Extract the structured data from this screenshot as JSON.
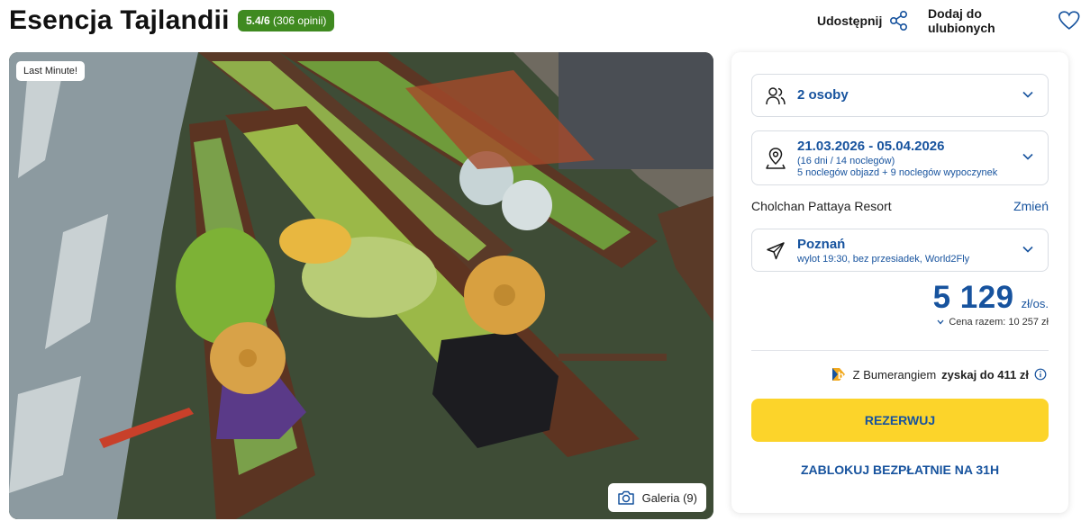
{
  "header": {
    "title": "Esencja Tajlandii",
    "rating": {
      "score": "5.4/6",
      "reviews": "(306 opinii)"
    },
    "share_label": "Udostępnij",
    "favorite_label": "Dodaj do ulubionych"
  },
  "gallery": {
    "badge": "Last Minute!",
    "button_label": "Galeria (9)"
  },
  "booking": {
    "persons": "2 osoby",
    "dates": {
      "range": "21.03.2026 - 05.04.2026",
      "duration": "(16 dni / 14 noclegów)",
      "detail": "5 noclegów objazd + 9 noclegów wypoczynek"
    },
    "hotel": {
      "name": "Cholchan Pattaya Resort",
      "change_label": "Zmień"
    },
    "flight": {
      "city": "Poznań",
      "detail": "wylot 19:30, bez przesiadek, World2Fly"
    },
    "price": {
      "value": "5 129",
      "unit": "zł/os.",
      "total": "Cena razem: 10 257 zł"
    },
    "bumerang": {
      "prefix": "Z Bumerangiem",
      "bold": "zyskaj do 411 zł"
    },
    "reserve_label": "REZERWUJ",
    "block_label": "ZABLOKUJ BEZPŁATNIE NA 31H"
  },
  "colors": {
    "brand_blue": "#17539e",
    "cta_yellow": "#fcd42a",
    "rating_green": "#3f8a20"
  },
  "icons": [
    "share-icon",
    "heart-icon",
    "camera-icon",
    "users-icon",
    "calendar-pin-icon",
    "plane-icon",
    "chevron-down-icon",
    "bumerang-logo-icon",
    "info-icon"
  ]
}
